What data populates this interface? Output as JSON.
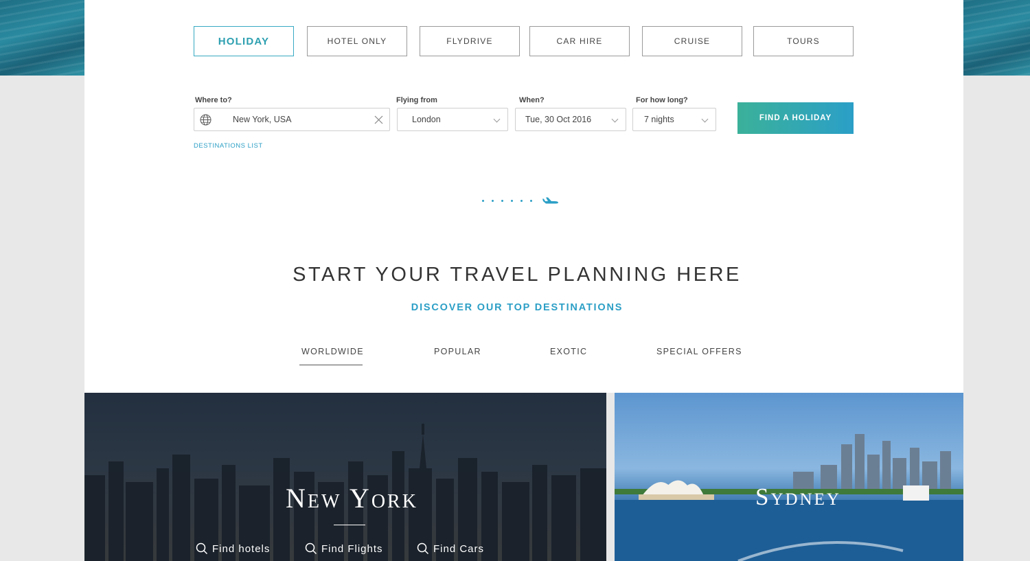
{
  "tabs": [
    {
      "label": "HOLIDAY",
      "active": true
    },
    {
      "label": "HOTEL ONLY",
      "active": false
    },
    {
      "label": "FLYDRIVE",
      "active": false
    },
    {
      "label": "CAR HIRE",
      "active": false
    },
    {
      "label": "CRUISE",
      "active": false
    },
    {
      "label": "TOURS",
      "active": false
    }
  ],
  "search": {
    "where_label": "Where to?",
    "where_value": "New York, USA",
    "from_label": "Flying from",
    "from_value": "London",
    "when_label": "When?",
    "when_value": "Tue, 30 Oct 2016",
    "duration_label": "For how long?",
    "duration_value": "7 nights",
    "button_label": "FIND A HOLIDAY",
    "destinations_link": "DESTINATIONS LIST"
  },
  "section": {
    "headline": "START YOUR TRAVEL PLANNING HERE",
    "subheadline": "DISCOVER OUR TOP DESTINATIONS",
    "categories": [
      "WORLDWIDE",
      "POPULAR",
      "EXOTIC",
      "SPECIAL OFFERS"
    ],
    "active_category": "WORLDWIDE"
  },
  "cards": [
    {
      "city": "New York",
      "actions": [
        "Find hotels",
        "Find Flights",
        "Find Cars"
      ]
    },
    {
      "city": "Sydney"
    }
  ],
  "colors": {
    "accent": "#2c9fc6",
    "active_tab": "#36a9c2",
    "button_start": "#3bb19a",
    "button_end": "#2b9fc7"
  },
  "icons": {
    "destination_field": "globe-icon",
    "clear": "close-icon",
    "dropdown": "chevron-down-icon",
    "loader": "airplane-icon",
    "quick_action": "search-icon"
  }
}
